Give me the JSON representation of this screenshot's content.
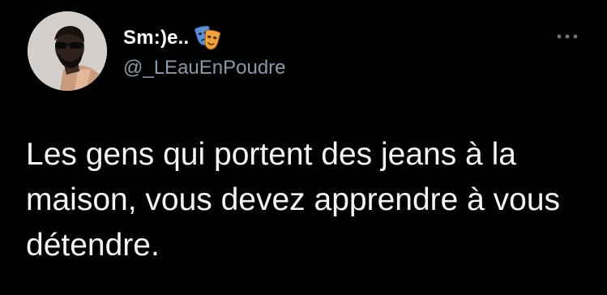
{
  "tweet": {
    "author": {
      "display_name": "Sm:)e..",
      "name_emoji": "performing-arts-masks-icon",
      "handle": "@_LEauEnPoudre"
    },
    "text": "Les gens qui portent des jeans à la maison, vous devez apprendre à vous détendre.",
    "more_icon": "more-horizontal-icon"
  },
  "colors": {
    "background": "#000000",
    "text_primary": "#e7e9ea",
    "text_secondary": "#8b98a5"
  }
}
